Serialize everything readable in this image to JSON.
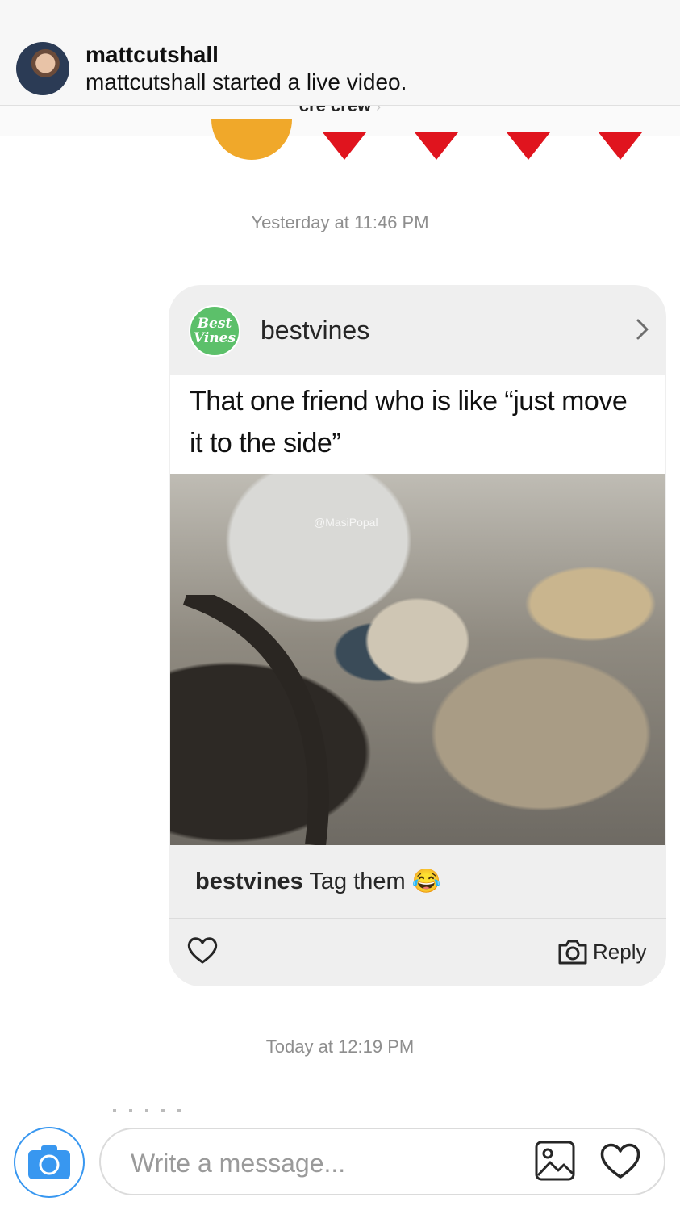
{
  "notification": {
    "username": "mattcutshall",
    "message": "mattcutshall started a live video."
  },
  "thread": {
    "title": "cre crew",
    "title_chevron": "›"
  },
  "timestamps": {
    "first": "Yesterday at 11:46 PM",
    "second": "Today at 12:19 PM"
  },
  "shared_post": {
    "avatar_text_line1": "Best",
    "avatar_text_line2": "Vines",
    "username": "bestvines",
    "text": "That one friend who is like “just move it to the side”",
    "image_watermark": "@MasiPopal",
    "caption_user": "bestvines",
    "caption_text": "Tag them",
    "caption_emoji": "😂",
    "reply_label": "Reply"
  },
  "composer": {
    "placeholder": "Write a message..."
  },
  "colors": {
    "accent_blue": "#3897f0",
    "heart_red": "#e0141e",
    "bestvines_green": "#5cc06a"
  }
}
